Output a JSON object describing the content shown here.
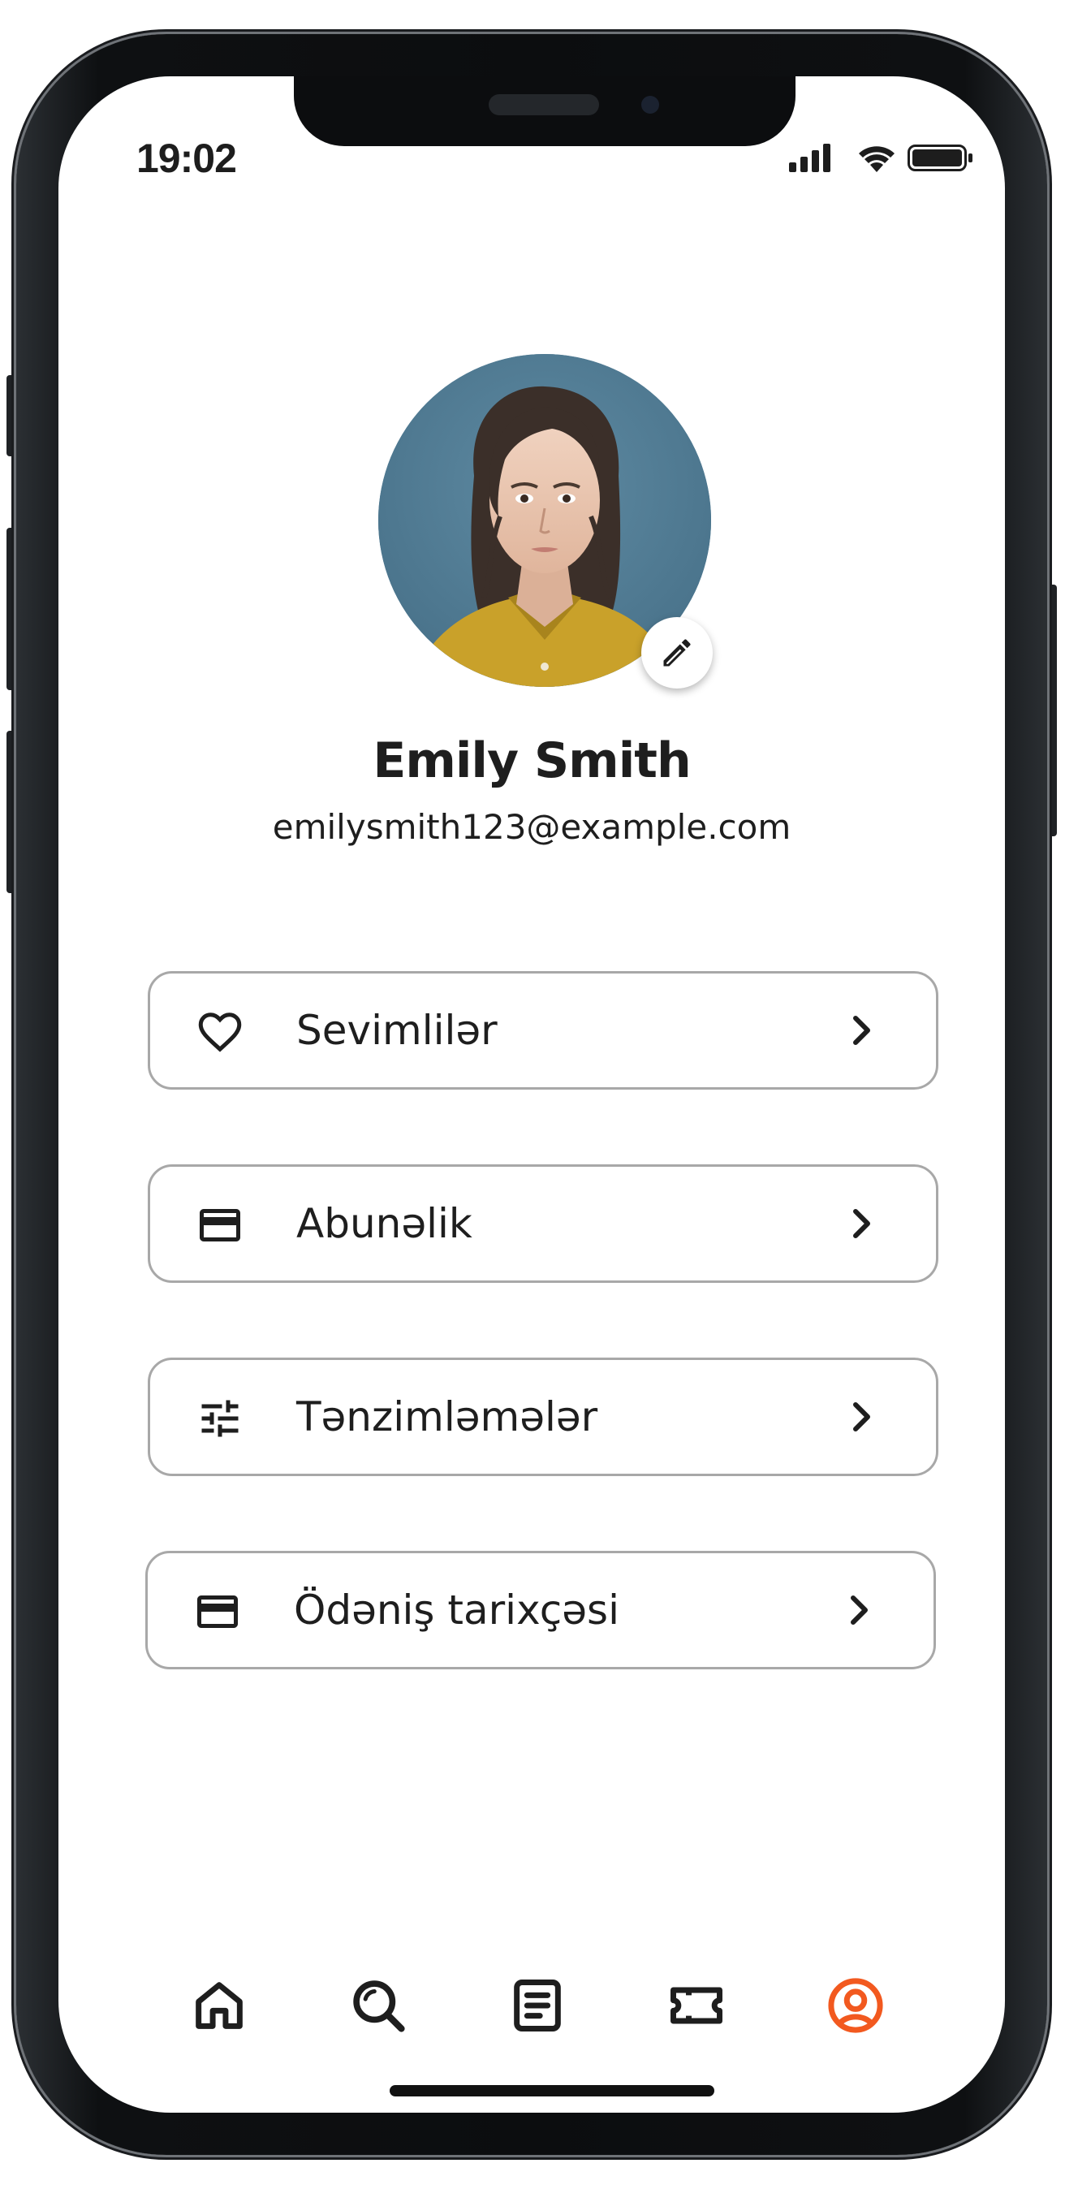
{
  "status_bar": {
    "time": "19:02"
  },
  "profile": {
    "name": "Emily Smith",
    "email": "emilysmith123@example.com"
  },
  "menu": [
    {
      "label": "Sevimlilər",
      "icon": "heart-icon"
    },
    {
      "label": "Abunəlik",
      "icon": "credit-card-icon"
    },
    {
      "label": "Tənzimləmələr",
      "icon": "sliders-icon"
    },
    {
      "label": "Ödəniş tarixçəsi",
      "icon": "credit-card-icon"
    }
  ],
  "tabs": [
    {
      "icon": "home-icon",
      "active": false
    },
    {
      "icon": "search-icon",
      "active": false
    },
    {
      "icon": "document-icon",
      "active": false
    },
    {
      "icon": "ticket-icon",
      "active": false
    },
    {
      "icon": "profile-icon",
      "active": true
    }
  ],
  "colors": {
    "accent": "#f2591f",
    "text": "#1e1e1e",
    "border": "#a8a8a8",
    "icon": "#1e1e1e"
  }
}
